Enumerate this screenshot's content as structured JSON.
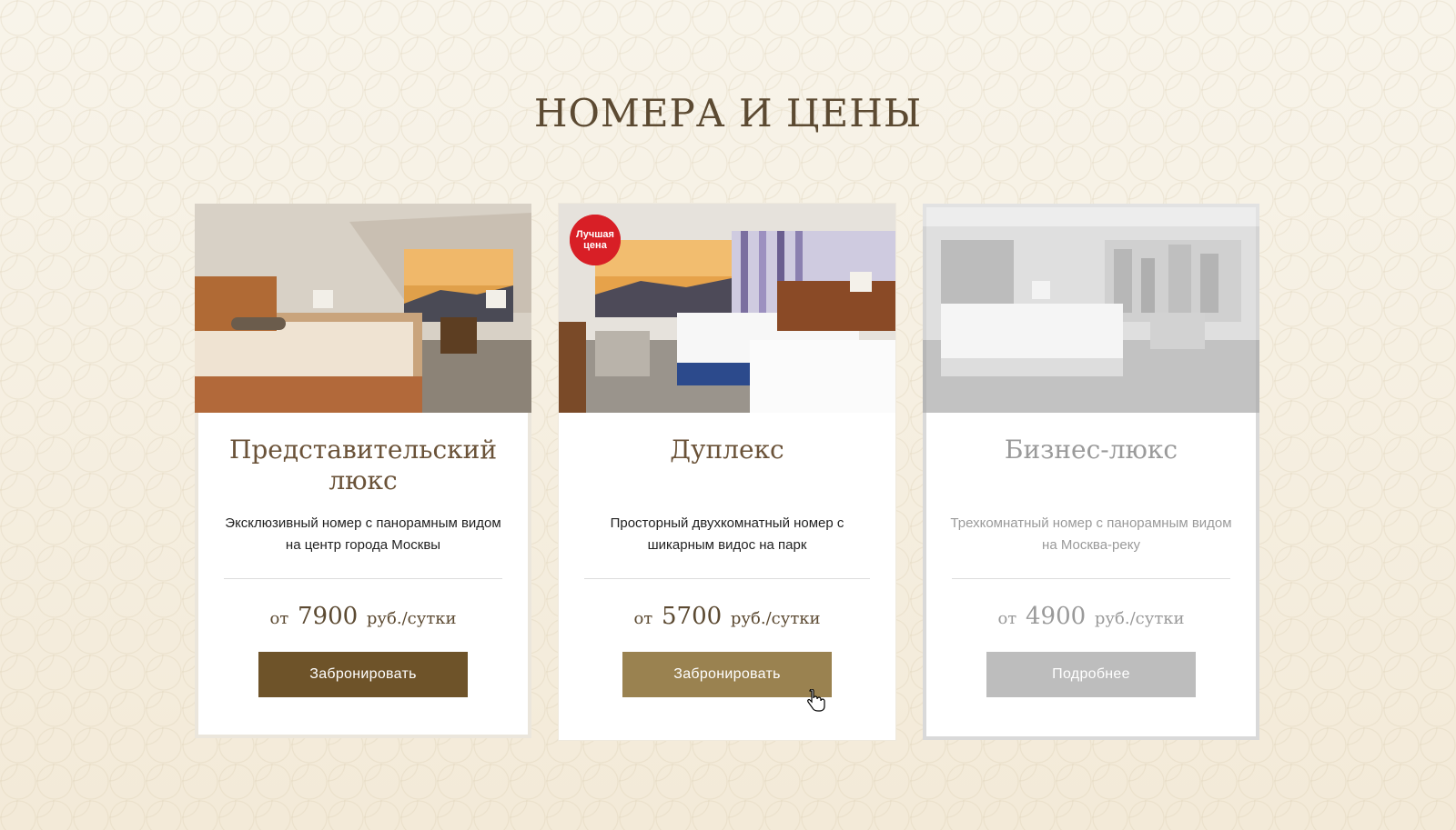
{
  "section": {
    "title": "НОМЕРА И ЦЕНЫ"
  },
  "rooms": [
    {
      "name": "Представительский люкс",
      "description": "Эксклюзивный номер с панорамным видом на центр города Москвы",
      "price_prefix": "от",
      "price": "7900",
      "price_unit": "руб./сутки",
      "button": "Забронировать"
    },
    {
      "badge": "Лучшая цена",
      "name": "Дуплекс",
      "description": "Просторный двухкомнатный номер с шикарным видос на парк",
      "price_prefix": "от",
      "price": "5700",
      "price_unit": "руб./сутки",
      "button": "Забронировать"
    },
    {
      "name": "Бизнес-люкс",
      "description": "Трехкомнатный номер с панорамным видом на Москва-реку",
      "price_prefix": "от",
      "price": "4900",
      "price_unit": "руб./сутки",
      "button": "Подробнее"
    }
  ],
  "colors": {
    "accent_dark": "#6e5329",
    "accent_light": "#9a8250",
    "disabled": "#bdbdbd",
    "badge": "#d81f26"
  }
}
